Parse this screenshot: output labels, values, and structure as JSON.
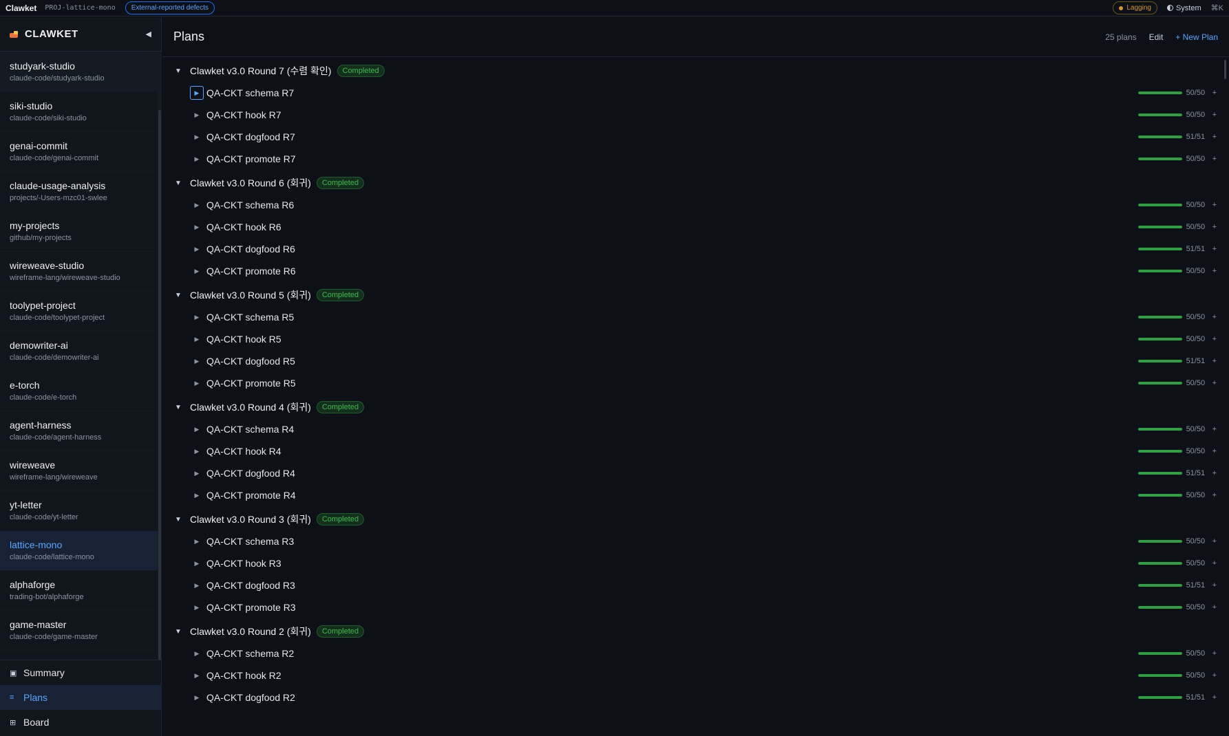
{
  "topbar": {
    "app_name": "Clawket",
    "project_code": "PROJ-lattice-mono",
    "filter_badge": "External-reported defects",
    "lag_label": "Lagging",
    "theme_label": "System",
    "shortcut": "⌘K"
  },
  "sidebar": {
    "brand": "CLAWKET",
    "collapse_glyph": "◀",
    "projects": [
      {
        "name": "studyark-studio",
        "path": "claude-code/studyark-studio"
      },
      {
        "name": "siki-studio",
        "path": "claude-code/siki-studio"
      },
      {
        "name": "genai-commit",
        "path": "claude-code/genai-commit"
      },
      {
        "name": "claude-usage-analysis",
        "path": "projects/-Users-mzc01-swlee"
      },
      {
        "name": "my-projects",
        "path": "github/my-projects"
      },
      {
        "name": "wireweave-studio",
        "path": "wireframe-lang/wireweave-studio"
      },
      {
        "name": "toolypet-project",
        "path": "claude-code/toolypet-project"
      },
      {
        "name": "demowriter-ai",
        "path": "claude-code/demowriter-ai"
      },
      {
        "name": "e-torch",
        "path": "claude-code/e-torch"
      },
      {
        "name": "agent-harness",
        "path": "claude-code/agent-harness"
      },
      {
        "name": "wireweave",
        "path": "wireframe-lang/wireweave"
      },
      {
        "name": "yt-letter",
        "path": "claude-code/yt-letter"
      },
      {
        "name": "lattice-mono",
        "path": "claude-code/lattice-mono"
      },
      {
        "name": "alphaforge",
        "path": "trading-bot/alphaforge"
      },
      {
        "name": "game-master",
        "path": "claude-code/game-master"
      }
    ],
    "active_project": "lattice-mono",
    "nav": [
      {
        "key": "summary",
        "label": "Summary",
        "icon": "▣"
      },
      {
        "key": "plans",
        "label": "Plans",
        "icon": "≡"
      },
      {
        "key": "board",
        "label": "Board",
        "icon": "⊞"
      }
    ],
    "active_nav": "plans"
  },
  "main": {
    "title": "Plans",
    "plan_count": "25 plans",
    "edit_label": "Edit",
    "new_plan_label": "+ New Plan",
    "groups": [
      {
        "title": "Clawket v3.0 Round 7 (수렴 확인)",
        "status": "Completed",
        "plans": [
          {
            "title": "QA-CKT schema R7",
            "done": 50,
            "total": 50,
            "count": "50/50"
          },
          {
            "title": "QA-CKT hook R7",
            "done": 50,
            "total": 50,
            "count": "50/50"
          },
          {
            "title": "QA-CKT dogfood R7",
            "done": 51,
            "total": 51,
            "count": "51/51"
          },
          {
            "title": "QA-CKT promote R7",
            "done": 50,
            "total": 50,
            "count": "50/50"
          }
        ]
      },
      {
        "title": "Clawket v3.0 Round 6 (회귀)",
        "status": "Completed",
        "plans": [
          {
            "title": "QA-CKT schema R6",
            "done": 50,
            "total": 50,
            "count": "50/50"
          },
          {
            "title": "QA-CKT hook R6",
            "done": 50,
            "total": 50,
            "count": "50/50"
          },
          {
            "title": "QA-CKT dogfood R6",
            "done": 51,
            "total": 51,
            "count": "51/51"
          },
          {
            "title": "QA-CKT promote R6",
            "done": 50,
            "total": 50,
            "count": "50/50"
          }
        ]
      },
      {
        "title": "Clawket v3.0 Round 5 (회귀)",
        "status": "Completed",
        "plans": [
          {
            "title": "QA-CKT schema R5",
            "done": 50,
            "total": 50,
            "count": "50/50"
          },
          {
            "title": "QA-CKT hook R5",
            "done": 50,
            "total": 50,
            "count": "50/50"
          },
          {
            "title": "QA-CKT dogfood R5",
            "done": 51,
            "total": 51,
            "count": "51/51"
          },
          {
            "title": "QA-CKT promote R5",
            "done": 50,
            "total": 50,
            "count": "50/50"
          }
        ]
      },
      {
        "title": "Clawket v3.0 Round 4 (회귀)",
        "status": "Completed",
        "plans": [
          {
            "title": "QA-CKT schema R4",
            "done": 50,
            "total": 50,
            "count": "50/50"
          },
          {
            "title": "QA-CKT hook R4",
            "done": 50,
            "total": 50,
            "count": "50/50"
          },
          {
            "title": "QA-CKT dogfood R4",
            "done": 51,
            "total": 51,
            "count": "51/51"
          },
          {
            "title": "QA-CKT promote R4",
            "done": 50,
            "total": 50,
            "count": "50/50"
          }
        ]
      },
      {
        "title": "Clawket v3.0 Round 3 (회귀)",
        "status": "Completed",
        "plans": [
          {
            "title": "QA-CKT schema R3",
            "done": 50,
            "total": 50,
            "count": "50/50"
          },
          {
            "title": "QA-CKT hook R3",
            "done": 50,
            "total": 50,
            "count": "50/50"
          },
          {
            "title": "QA-CKT dogfood R3",
            "done": 51,
            "total": 51,
            "count": "51/51"
          },
          {
            "title": "QA-CKT promote R3",
            "done": 50,
            "total": 50,
            "count": "50/50"
          }
        ]
      },
      {
        "title": "Clawket v3.0 Round 2 (회귀)",
        "status": "Completed",
        "plans": [
          {
            "title": "QA-CKT schema R2",
            "done": 50,
            "total": 50,
            "count": "50/50"
          },
          {
            "title": "QA-CKT hook R2",
            "done": 50,
            "total": 50,
            "count": "50/50"
          },
          {
            "title": "QA-CKT dogfood R2",
            "done": 51,
            "total": 51,
            "count": "51/51"
          }
        ]
      }
    ],
    "focused_plan": "QA-CKT schema R7",
    "expanded_glyph": "▼",
    "collapsed_glyph": "▶",
    "add_glyph": "+"
  },
  "colors": {
    "background": "#0d1117",
    "accent": "#58a6ff",
    "success": "#3fb950",
    "progress": "#2ea043",
    "warning": "#d29922"
  },
  "icons": {
    "brand": "clawket-logo-icon",
    "collapse": "chevron-left-icon",
    "theme": "half-circle-icon",
    "expanded": "caret-down-icon",
    "collapsed": "caret-right-icon",
    "add": "plus-icon"
  }
}
